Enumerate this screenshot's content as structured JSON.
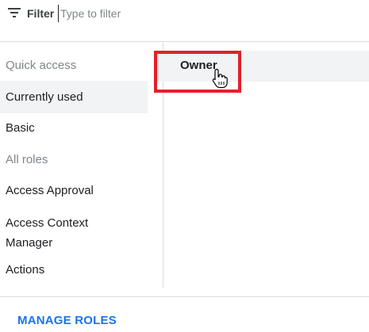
{
  "filter": {
    "label": "Filter",
    "placeholder": "Type to filter",
    "icon": "filter-list-icon"
  },
  "categories": {
    "quick_access_header": "Quick access",
    "currently_used": "Currently used",
    "basic": "Basic",
    "all_roles_header": "All roles",
    "access_approval": "Access Approval",
    "access_context_manager_line1": "Access Context",
    "access_context_manager_line2": "Manager",
    "actions": "Actions"
  },
  "roles": {
    "owner": "Owner"
  },
  "footer": {
    "manage_roles": "MANAGE ROLES"
  },
  "colors": {
    "accent_blue": "#1a73e8",
    "highlight_red": "#e3202b",
    "selected_bg": "#f1f3f4",
    "divider": "#dadce0"
  }
}
